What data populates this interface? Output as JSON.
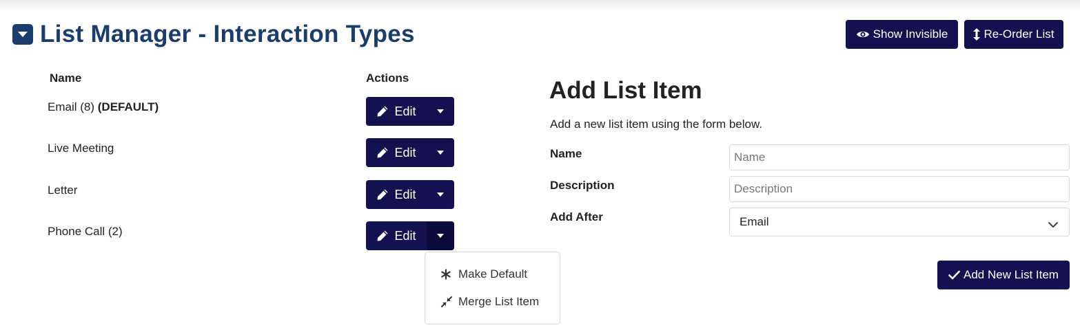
{
  "header": {
    "title": "List Manager - Interaction Types",
    "collapse_icon": "caret-down-square-icon",
    "show_invisible_label": "Show Invisible",
    "reorder_label": "Re-Order List"
  },
  "table": {
    "columns": {
      "name": "Name",
      "actions": "Actions"
    },
    "rows": [
      {
        "name": "Email (8)",
        "badge": "(DEFAULT)",
        "edit_label": "Edit"
      },
      {
        "name": "Live Meeting",
        "badge": "",
        "edit_label": "Edit"
      },
      {
        "name": "Letter",
        "badge": "",
        "edit_label": "Edit"
      },
      {
        "name": "Phone Call (2)",
        "badge": "",
        "edit_label": "Edit"
      }
    ]
  },
  "dropdown_menu": {
    "items": [
      {
        "label": "Make Default",
        "icon": "asterisk-icon"
      },
      {
        "label": "Merge List Item",
        "icon": "compress-arrows-icon"
      }
    ]
  },
  "form": {
    "title": "Add List Item",
    "description": "Add a new list item using the form below.",
    "name_label": "Name",
    "name_placeholder": "Name",
    "description_label": "Description",
    "description_placeholder": "Description",
    "add_after_label": "Add After",
    "add_after_value": "Email",
    "submit_label": "Add New List Item"
  },
  "colors": {
    "title": "#1b3d6b",
    "button": "#11124f"
  }
}
